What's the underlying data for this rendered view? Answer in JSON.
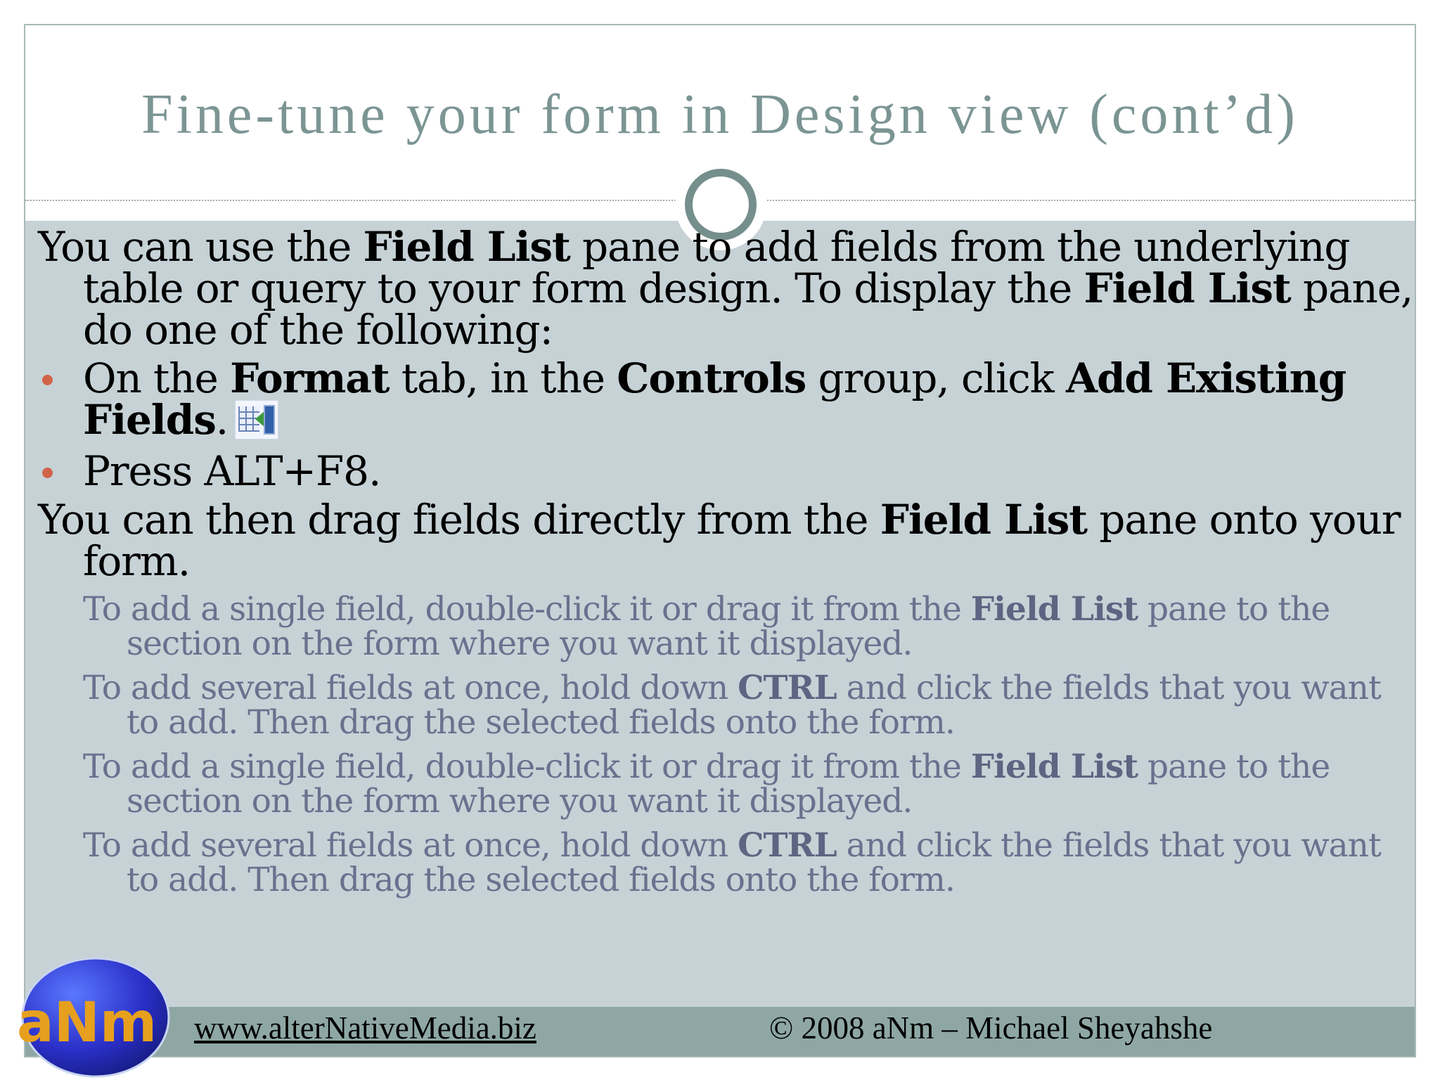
{
  "slide": {
    "title": "Fine-tune your form in Design view (cont’d)"
  },
  "para1": {
    "t1": "You can use the ",
    "b1": "Field List",
    "t2": " pane to add fields from the underlying table or query to your form design. To display the ",
    "b2": "Field List",
    "t3": " pane, do one of the following:"
  },
  "bullet1": {
    "t1": "On the ",
    "b1": "Format",
    "t2": " tab, in the ",
    "b2": "Controls",
    "t3": " group, click ",
    "b3": "Add Existing Fields",
    "t4": ".",
    "icon": "add-existing-fields-icon"
  },
  "bullet2": {
    "text": "Press ALT+F8."
  },
  "para2": {
    "t1": "You can then drag fields directly from the ",
    "b1": "Field List",
    "t2": " pane onto your form."
  },
  "sub1": {
    "t1": "To add a single field, double-click it or drag it from the ",
    "b1": "Field List",
    "t2": " pane to the section on the form where you want it displayed."
  },
  "sub2": {
    "t1": "To add several fields at once, hold down ",
    "b1": "CTRL",
    "t2": " and click the fields that you want to add. Then drag the selected fields onto the form."
  },
  "sub3": {
    "t1": "To add a single field, double-click it or drag it from the ",
    "b1": "Field List",
    "t2": " pane to the section on the form where you want it displayed."
  },
  "sub4": {
    "t1": "To add several fields at once, hold down ",
    "b1": "CTRL",
    "t2": " and click the fields that you want to add. Then drag the selected fields onto the form."
  },
  "footer": {
    "url": "www.alterNativeMedia.biz",
    "copyright": "© 2008 aNm – Michael Sheyahshe",
    "logo_text": "aNm"
  },
  "colors": {
    "title": "#7b9593",
    "content_bg": "#c6d2d6",
    "footer_bg": "#8ea7a5",
    "bullet": "#d16349",
    "sub_text": "#68728e",
    "logo_blue": "#2a2fc8",
    "logo_orange": "#e6a01e"
  }
}
